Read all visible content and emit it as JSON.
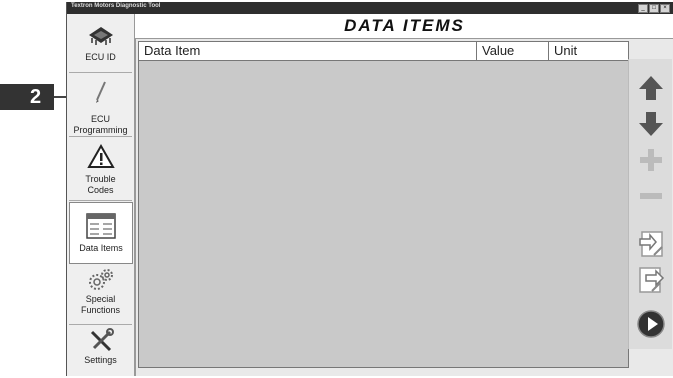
{
  "window": {
    "title": "Textron Motors Diagnostic Tool",
    "controls": [
      "_",
      "□",
      "×"
    ]
  },
  "header": {
    "title": "DATA ITEMS"
  },
  "sidebar": {
    "items": [
      {
        "label": "ECU ID",
        "icon": "chip-icon"
      },
      {
        "label": "ECU Programming",
        "icon": "pen-icon"
      },
      {
        "label": "Trouble Codes",
        "icon": "warning-triangle-icon"
      },
      {
        "label": "Data Items",
        "icon": "data-list-icon",
        "active": true
      },
      {
        "label": "Special Functions",
        "icon": "gears-icon"
      },
      {
        "label": "Settings",
        "icon": "tools-icon"
      }
    ]
  },
  "table": {
    "columns": [
      "Data Item",
      "Value",
      "Unit"
    ],
    "rows": []
  },
  "toolbar": {
    "buttons": [
      "arrow-up-icon",
      "arrow-down-icon",
      "plus-icon",
      "minus-icon",
      "import-icon",
      "export-icon",
      "play-icon"
    ]
  },
  "callout": {
    "label": "2"
  }
}
